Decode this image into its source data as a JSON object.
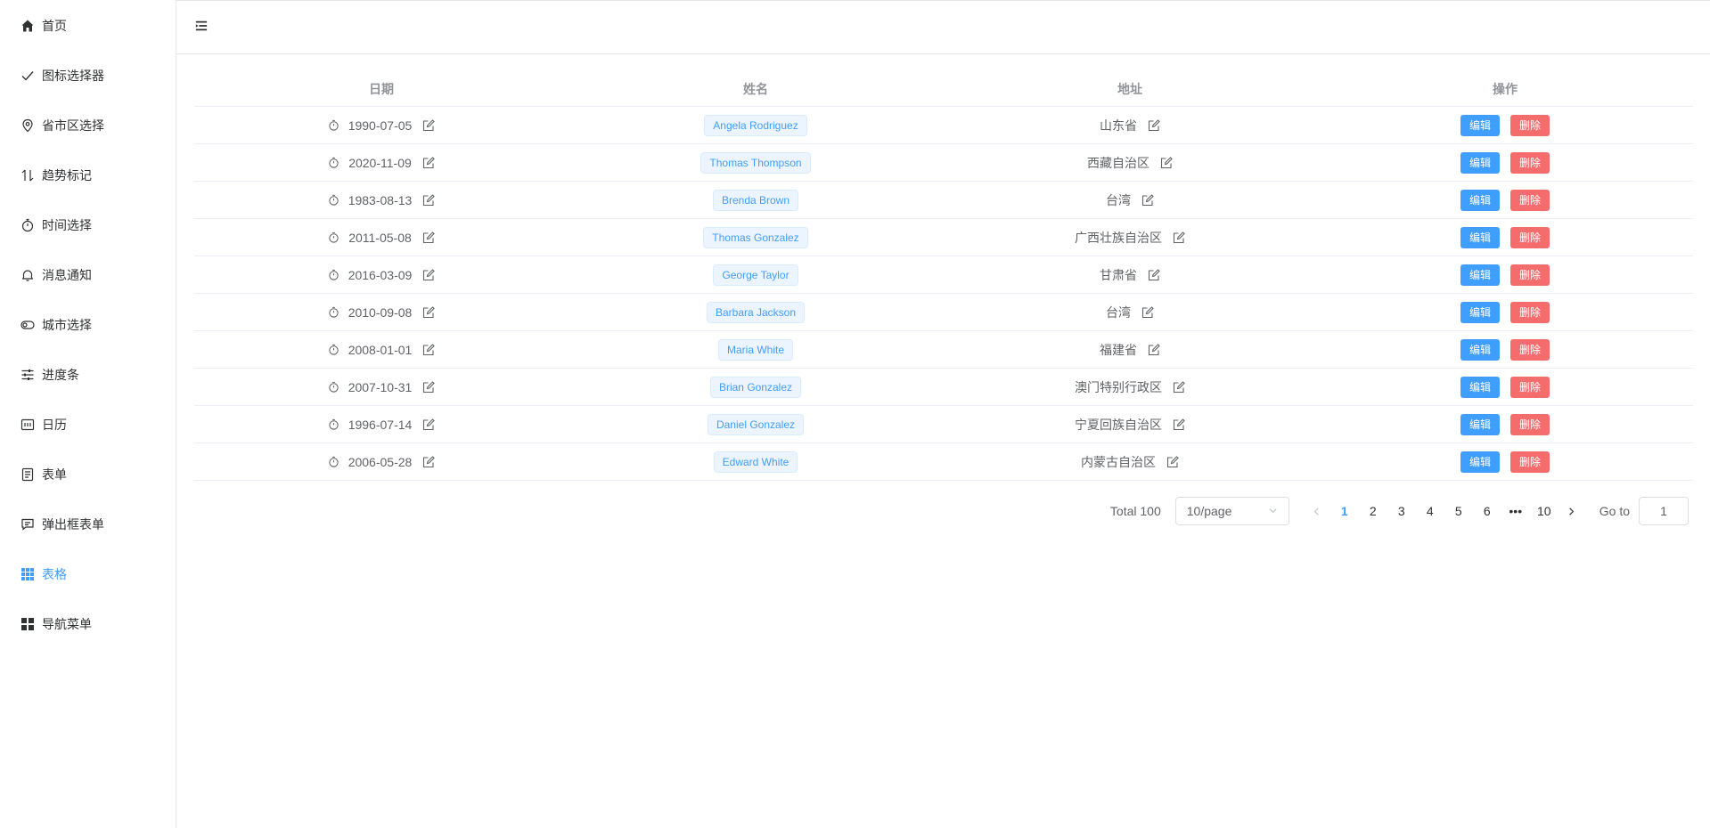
{
  "sidebar": {
    "items": [
      {
        "label": "首页",
        "icon": "home-icon"
      },
      {
        "label": "图标选择器",
        "icon": "check-icon"
      },
      {
        "label": "省市区选择",
        "icon": "location-icon"
      },
      {
        "label": "趋势标记",
        "icon": "trend-icon"
      },
      {
        "label": "时间选择",
        "icon": "stopwatch-icon"
      },
      {
        "label": "消息通知",
        "icon": "bell-icon"
      },
      {
        "label": "城市选择",
        "icon": "toggle-icon"
      },
      {
        "label": "进度条",
        "icon": "sliders-icon"
      },
      {
        "label": "日历",
        "icon": "calendar-icon"
      },
      {
        "label": "表单",
        "icon": "document-icon"
      },
      {
        "label": "弹出框表单",
        "icon": "chat-icon"
      },
      {
        "label": "表格",
        "icon": "grid-icon",
        "active": true
      },
      {
        "label": "导航菜单",
        "icon": "menu-grid-icon"
      }
    ],
    "active_color": "#409eff"
  },
  "table": {
    "headers": {
      "date": "日期",
      "name": "姓名",
      "address": "地址",
      "actions": "操作"
    },
    "edit_label": "编辑",
    "delete_label": "删除",
    "rows": [
      {
        "date": "1990-07-05",
        "name": "Angela Rodriguez",
        "address": "山东省"
      },
      {
        "date": "2020-11-09",
        "name": "Thomas Thompson",
        "address": "西藏自治区"
      },
      {
        "date": "1983-08-13",
        "name": "Brenda Brown",
        "address": "台湾"
      },
      {
        "date": "2011-05-08",
        "name": "Thomas Gonzalez",
        "address": "广西壮族自治区"
      },
      {
        "date": "2016-03-09",
        "name": "George Taylor",
        "address": "甘肃省"
      },
      {
        "date": "2010-09-08",
        "name": "Barbara Jackson",
        "address": "台湾"
      },
      {
        "date": "2008-01-01",
        "name": "Maria White",
        "address": "福建省"
      },
      {
        "date": "2007-10-31",
        "name": "Brian Gonzalez",
        "address": "澳门特别行政区"
      },
      {
        "date": "1996-07-14",
        "name": "Daniel Gonzalez",
        "address": "宁夏回族自治区"
      },
      {
        "date": "2006-05-28",
        "name": "Edward White",
        "address": "内蒙古自治区"
      }
    ]
  },
  "pagination": {
    "total": "Total 100",
    "page_size": "10/page",
    "pages": [
      "1",
      "2",
      "3",
      "4",
      "5",
      "6",
      "•••",
      "10"
    ],
    "current": "1",
    "goto_label": "Go to",
    "goto_value": "1"
  },
  "colors": {
    "primary": "#409eff",
    "danger": "#f56c6c",
    "tag_bg": "#ecf5ff"
  }
}
